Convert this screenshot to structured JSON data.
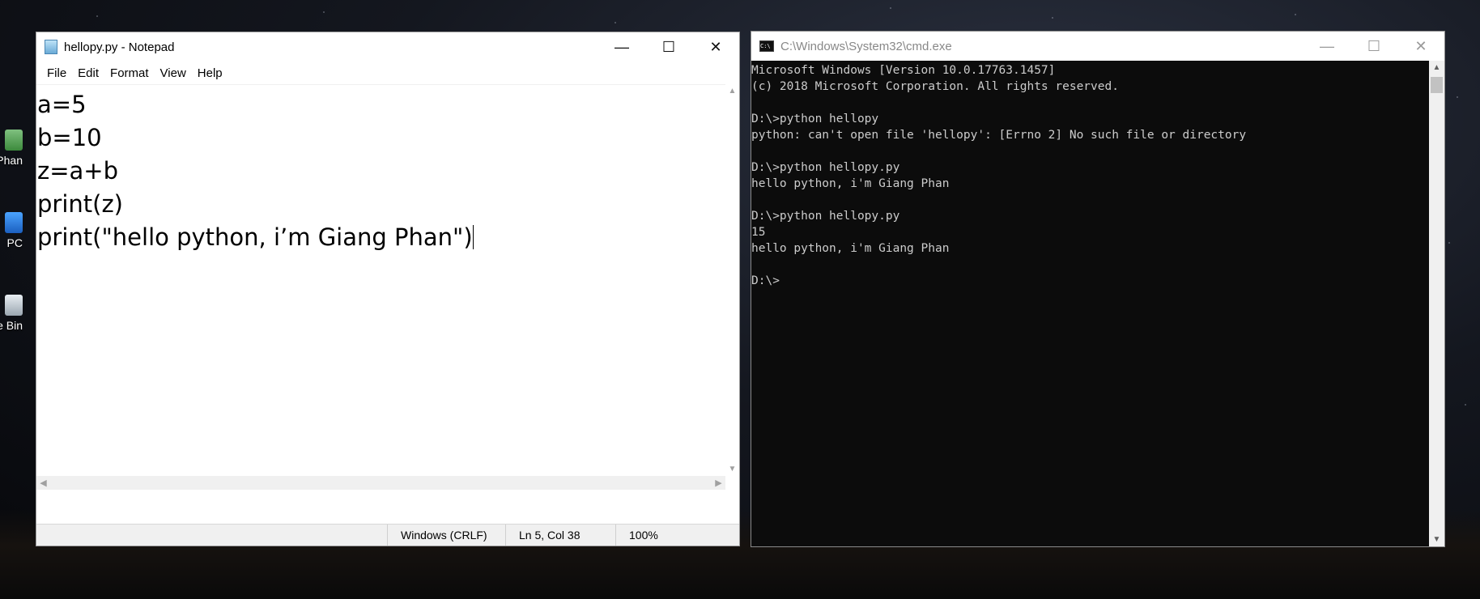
{
  "desktop": {
    "icons": [
      {
        "label": "Phan",
        "icon": "user-folder-icon"
      },
      {
        "label": "PC",
        "icon": "computer-icon"
      },
      {
        "label": "e Bin",
        "icon": "recycle-bin-icon"
      }
    ]
  },
  "notepad": {
    "title": "hellopy.py - Notepad",
    "controls": {
      "minimize": "—",
      "maximize": "☐",
      "close": "✕"
    },
    "menu": [
      "File",
      "Edit",
      "Format",
      "View",
      "Help"
    ],
    "content_lines": [
      "a=5",
      "b=10",
      "z=a+b",
      "print(z)",
      "print(\"hello python, i’m Giang Phan\")"
    ],
    "status": {
      "line_ending": "Windows (CRLF)",
      "position": "Ln 5, Col 38",
      "zoom": "100%"
    }
  },
  "cmd": {
    "title": "C:\\Windows\\System32\\cmd.exe",
    "icon_text": "C:\\",
    "controls": {
      "minimize": "—",
      "maximize": "☐",
      "close": "✕"
    },
    "lines": [
      "Microsoft Windows [Version 10.0.17763.1457]",
      "(c) 2018 Microsoft Corporation. All rights reserved.",
      "",
      "D:\\>python hellopy",
      "python: can't open file 'hellopy': [Errno 2] No such file or directory",
      "",
      "D:\\>python hellopy.py",
      "hello python, i'm Giang Phan",
      "",
      "D:\\>python hellopy.py",
      "15",
      "hello python, i'm Giang Phan",
      "",
      "D:\\>"
    ]
  },
  "scroll_glyphs": {
    "up": "▲",
    "down": "▼",
    "left": "◀",
    "right": "▶"
  }
}
